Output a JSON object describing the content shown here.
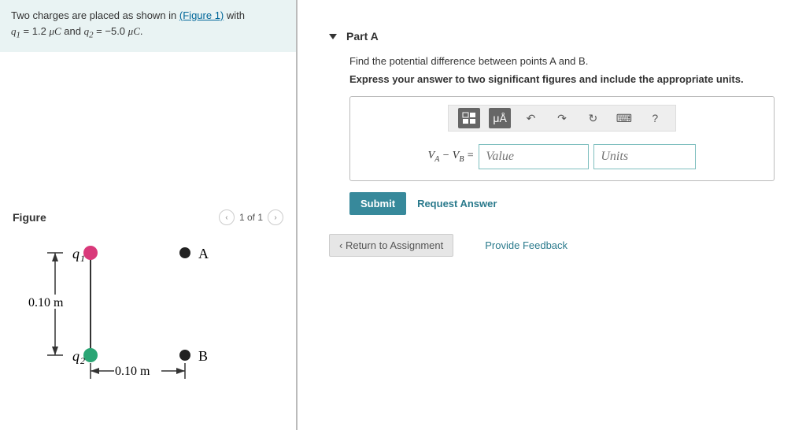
{
  "problem": {
    "prefix": "Two charges are placed as shown in ",
    "figure_link_text": "(Figure 1)",
    "suffix": " with",
    "q1_label": "q",
    "q1_sub": "1",
    "eq": " = ",
    "q1_value": "1.2",
    "micro1": " μC",
    "and": " and ",
    "q2_label": "q",
    "q2_sub": "2",
    "q2_value": "−5.0",
    "micro2": " μC",
    "period": "."
  },
  "figure": {
    "heading": "Figure",
    "pager": "1 of 1",
    "q1_label": "q",
    "q1_sub": "1",
    "q2_label": "q",
    "q2_sub": "2",
    "pointA": "A",
    "pointB": "B",
    "dist_v": "0.10 m",
    "dist_h": "0.10 m"
  },
  "part": {
    "title": "Part A",
    "question": "Find the potential difference between points A and B.",
    "instruction": "Express your answer to two significant figures and include the appropriate units.",
    "eq_left_1": "V",
    "eq_left_1s": "A",
    "eq_minus": " − ",
    "eq_left_2": "V",
    "eq_left_2s": "B",
    "eq_equals": " =",
    "value_placeholder": "Value",
    "units_placeholder": "Units",
    "submit": "Submit",
    "request_answer": "Request Answer",
    "toolbar": {
      "templates": "⊞",
      "special": "μÅ",
      "undo": "↶",
      "redo": "↷",
      "reset": "↻",
      "keyboard": "⌨",
      "help": "?"
    }
  },
  "nav": {
    "return": "Return to Assignment",
    "feedback": "Provide Feedback"
  }
}
